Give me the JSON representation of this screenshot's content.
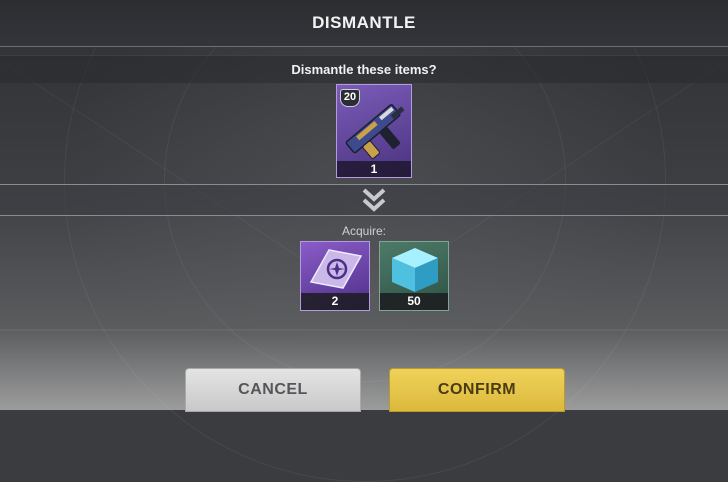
{
  "dialog": {
    "title": "DISMANTLE",
    "prompt": "Dismantle these items?"
  },
  "item": {
    "icon": "submachine-gun-icon",
    "level": "20",
    "quantity": "1",
    "rarity_color": "#5b3f96"
  },
  "divider": {
    "icon": "double-chevron-down-icon"
  },
  "acquire": {
    "label": "Acquire:",
    "rewards": [
      {
        "icon": "glimmer-crystal-icon",
        "quantity": "2",
        "color": "#6b45a8"
      },
      {
        "icon": "blue-cube-icon",
        "quantity": "50",
        "color": "#3d6a58"
      }
    ]
  },
  "buttons": {
    "cancel_label": "CANCEL",
    "confirm_label": "CONFIRM",
    "confirm_color": "#e6c64a"
  }
}
